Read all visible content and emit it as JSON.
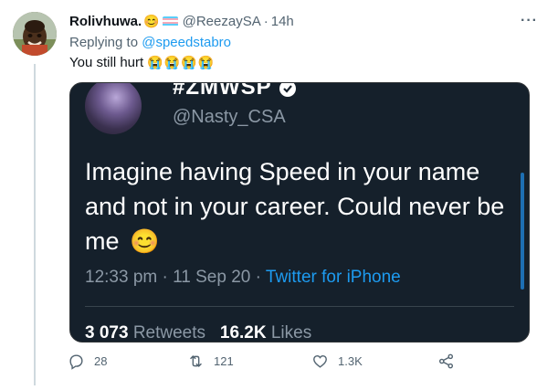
{
  "tweet": {
    "display_name": "Rolivhuwa.",
    "name_emoji": "😊",
    "handle": "@ReezaySA",
    "time": "14h",
    "replying_to_prefix": "Replying to",
    "replying_to_handle": "@speedstabro",
    "text": "You still hurt",
    "text_emojis": "😭😭😭😭"
  },
  "quoted_screenshot": {
    "title": "#ZMWSP",
    "handle": "@Nasty_CSA",
    "body": "Imagine having Speed in your name and not in your career. Could never be me",
    "body_emoji": "😊",
    "time": "12:33 pm",
    "date": "11 Sep 20",
    "source": "Twitter for iPhone",
    "retweets_count": "3 073",
    "retweets_label": "Retweets",
    "likes_count": "16.2K",
    "likes_label": "Likes"
  },
  "actions": {
    "replies": "28",
    "retweets": "121",
    "likes": "1.3K"
  },
  "colors": {
    "accent": "#1d9bf0",
    "muted": "#536471",
    "dark_bg": "#15202b"
  },
  "icons": [
    "more-icon",
    "reply-icon",
    "retweet-icon",
    "like-icon",
    "share-icon",
    "verified-icon"
  ]
}
